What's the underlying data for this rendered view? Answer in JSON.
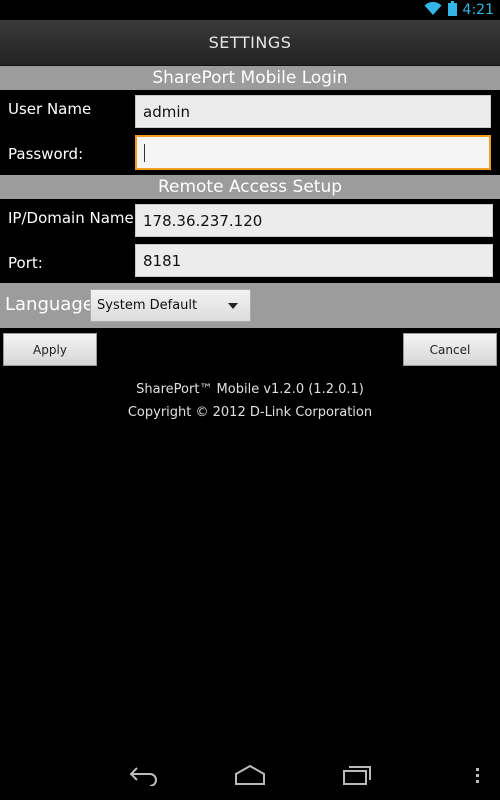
{
  "status_bar": {
    "time": "4:21",
    "icons": [
      "wifi-icon",
      "battery-icon"
    ]
  },
  "header": {
    "title": "SETTINGS"
  },
  "login_section": {
    "title": "SharePort Mobile Login",
    "username_label": "User Name",
    "username_value": "admin",
    "password_label": "Password:",
    "password_value": ""
  },
  "remote_section": {
    "title": "Remote Access Setup",
    "ip_label": "IP/Domain Name:",
    "ip_value": "178.36.237.120",
    "port_label": "Port:",
    "port_value": "8181"
  },
  "language": {
    "label": "Language",
    "selected": "System Default"
  },
  "actions": {
    "apply_label": "Apply",
    "cancel_label": "Cancel"
  },
  "footer": {
    "version": "SharePort™ Mobile v1.2.0 (1.2.0.1)",
    "copyright": "Copyright © 2012 D-Link Corporation"
  },
  "nav": {
    "icons": [
      "back-icon",
      "home-icon",
      "recent-apps-icon",
      "menu-icon"
    ]
  },
  "colors": {
    "accent": "#33b5e5",
    "focus_border": "#f29c21",
    "section_bg": "#9c9c9c"
  }
}
